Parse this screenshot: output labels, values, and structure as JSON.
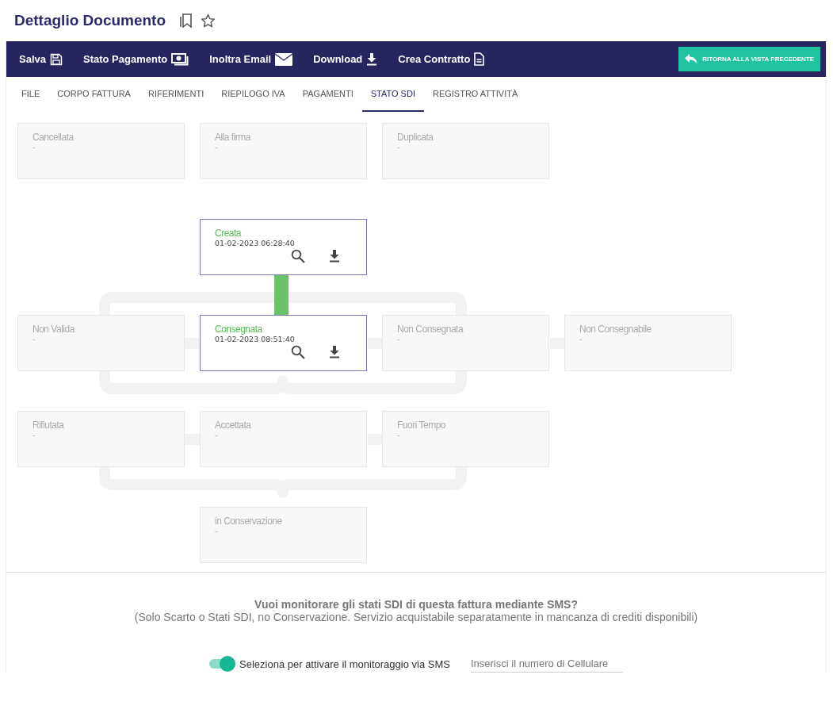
{
  "page": {
    "title": "Dettaglio Documento"
  },
  "toolbar": {
    "actions": [
      {
        "label": "Salva"
      },
      {
        "label": "Stato Pagamento"
      },
      {
        "label": "Inoltra Email"
      },
      {
        "label": "Download"
      },
      {
        "label": "Crea Contratto"
      }
    ],
    "back_button": "RITORNA ALLA VISTA PRECEDENTE"
  },
  "tabs": [
    {
      "label": "FILE",
      "selected": false
    },
    {
      "label": "CORPO FATTURA",
      "selected": false
    },
    {
      "label": "RIFERIMENTI",
      "selected": false
    },
    {
      "label": "RIEPILOGO IVA",
      "selected": false
    },
    {
      "label": "PAGAMENTI",
      "selected": false
    },
    {
      "label": "STATO SDI",
      "selected": true
    },
    {
      "label": "REGISTRO ATTIVITÀ",
      "selected": false
    }
  ],
  "status_rows": [
    [
      {
        "title": "Cancellata",
        "detail": "-",
        "active": false
      },
      {
        "title": "Alla firma",
        "detail": "-",
        "active": false
      },
      {
        "title": "Duplicata",
        "detail": "-",
        "active": false
      }
    ],
    [
      null,
      {
        "title": "Creata",
        "detail": "01-02-2023 06:28:40",
        "active": true
      }
    ],
    [
      {
        "title": "Non Valida",
        "detail": "-",
        "active": false
      },
      {
        "title": "Consegnata",
        "detail": "01-02-2023 08:51:40",
        "active": true
      },
      {
        "title": "Non Consegnata",
        "detail": "-",
        "active": false
      },
      {
        "title": "Non Consegnabile",
        "detail": "-",
        "active": false
      }
    ],
    [
      {
        "title": "Rifiutata",
        "detail": "-",
        "active": false
      },
      {
        "title": "Accettata",
        "detail": "-",
        "active": false
      },
      {
        "title": "Fuori Tempo",
        "detail": "-",
        "active": false
      }
    ],
    [
      null,
      {
        "title": "in Conservazione",
        "detail": "-",
        "active": false
      }
    ]
  ],
  "sms": {
    "question": "Vuoi monitorare gli stati SDI di questa fattura mediante SMS?",
    "note": "(Solo Scarto o Stati SDI, no Conservazione. Servizio acquistabile separatamente in mancanza di crediti disponibili)",
    "toggle_label": "Seleziona per attivare il monitoraggio via SMS",
    "toggle_on": true,
    "phone_placeholder": "Inserisci il numero di Cellulare"
  }
}
